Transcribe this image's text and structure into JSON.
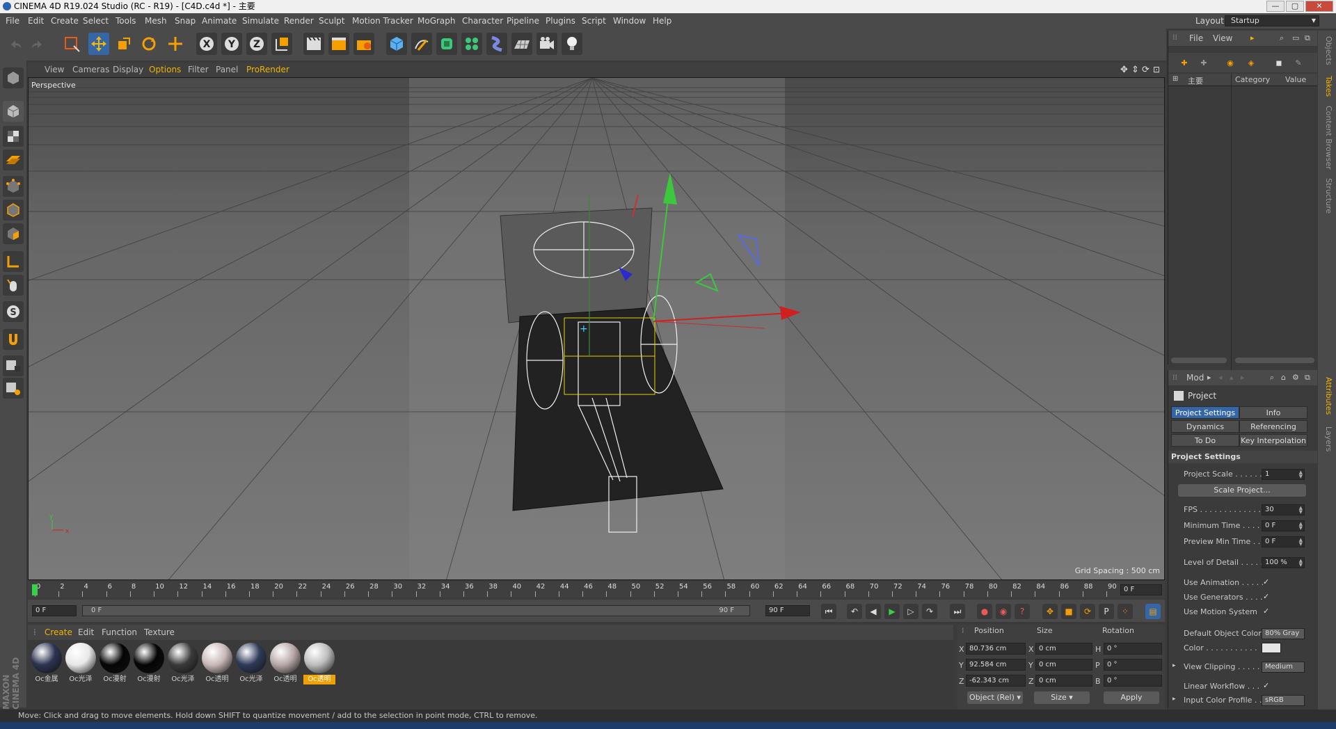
{
  "window": {
    "title": "CINEMA 4D R19.024 Studio (RC - R19) - [C4D.c4d *] - 主要",
    "buttons": [
      "—",
      "▢",
      "✕"
    ]
  },
  "menubar": {
    "items": [
      "File",
      "Edit",
      "Create",
      "Select",
      "Tools",
      "Mesh",
      "Snap",
      "Animate",
      "Simulate",
      "Render",
      "Sculpt",
      "Motion Tracker",
      "MoGraph",
      "Character",
      "Pipeline",
      "Plugins",
      "Script",
      "Window",
      "Help"
    ],
    "layout_label": "Layout:",
    "layout_value": "Startup"
  },
  "toolbar": {
    "axis_x": "X",
    "axis_y": "Y",
    "axis_z": "Z"
  },
  "viewport": {
    "menu": [
      "View",
      "Cameras",
      "Display",
      "Options",
      "Filter",
      "Panel",
      "ProRender"
    ],
    "active_menu": "Options",
    "label": "Perspective",
    "grid_spacing": "Grid Spacing : 500 cm",
    "axis_x": "x",
    "axis_y": "y"
  },
  "timeline": {
    "ticks": [
      "0",
      "2",
      "4",
      "6",
      "8",
      "10",
      "12",
      "14",
      "16",
      "18",
      "20",
      "22",
      "24",
      "26",
      "28",
      "30",
      "32",
      "34",
      "36",
      "38",
      "40",
      "42",
      "44",
      "46",
      "48",
      "50",
      "52",
      "54",
      "56",
      "58",
      "60",
      "62",
      "64",
      "66",
      "68",
      "70",
      "72",
      "74",
      "76",
      "78",
      "80",
      "82",
      "84",
      "86",
      "88",
      "90"
    ],
    "current_frame": "0 F",
    "start_field": "0 F",
    "range_start": "0 F",
    "range_end": "90 F",
    "end_field": "90 F",
    "current_frame_pct": 0
  },
  "materials": {
    "menu": [
      "Create",
      "Edit",
      "Function",
      "Texture"
    ],
    "items": [
      {
        "label": "Oc金属",
        "color": "#2b3350"
      },
      {
        "label": "Oc光泽",
        "color": "#e8e8e8"
      },
      {
        "label": "Oc漫射",
        "color": "#050505"
      },
      {
        "label": "Oc漫射",
        "color": "#050505"
      },
      {
        "label": "Oc光泽",
        "color": "#3a3a3a"
      },
      {
        "label": "Oc透明",
        "color": "#c9b8b8"
      },
      {
        "label": "Oc光泽",
        "color": "#2f3a58"
      },
      {
        "label": "Oc透明",
        "color": "#b8a8a8"
      },
      {
        "label": "Oc透明",
        "color": "#bdbdbd"
      }
    ],
    "selected_index": 8
  },
  "coordinates": {
    "headers": [
      "Position",
      "Size",
      "Rotation"
    ],
    "rows": [
      {
        "axis": "X",
        "position": "80.736 cm",
        "size_axis": "X",
        "size": "0 cm",
        "rot_axis": "H",
        "rotation": "0 °"
      },
      {
        "axis": "Y",
        "position": "92.584 cm",
        "size_axis": "Y",
        "size": "0 cm",
        "rot_axis": "P",
        "rotation": "0 °"
      },
      {
        "axis": "Z",
        "position": "-62.343 cm",
        "size_axis": "Z",
        "size": "0 cm",
        "rot_axis": "B",
        "rotation": "0 °"
      }
    ],
    "mode": "Object (Rel)",
    "size_mode": "Size",
    "apply": "Apply"
  },
  "object_manager": {
    "menu": [
      "File",
      "View"
    ],
    "header_col1": "主要",
    "header_col2": "Category",
    "header_col3": "Value"
  },
  "right_tabs_top": [
    "Objects",
    "Takes",
    "Content Browser",
    "Structure"
  ],
  "right_tabs_bottom": [
    "Attributes",
    "Layers"
  ],
  "attributes": {
    "mode": "Mod",
    "object": "Project",
    "tabs": [
      [
        "Project Settings",
        "Info"
      ],
      [
        "Dynamics",
        "Referencing"
      ],
      [
        "To Do",
        "Key Interpolation"
      ]
    ],
    "active_tab": "Project Settings",
    "section": "Project Settings",
    "fields": [
      {
        "label": "Project Scale . . . . . .",
        "value": "1"
      },
      {
        "label": "FPS . . . . . . . . . . . . . .",
        "value": "30"
      },
      {
        "label": "Minimum Time . . . . .",
        "value": "0 F"
      },
      {
        "label": "Preview Min Time . . .",
        "value": "0 F"
      },
      {
        "label": "Level of Detail . . . . .",
        "value": "100 %"
      }
    ],
    "scale_button": "Scale Project...",
    "checks": [
      {
        "label": "Use Animation . . . . .",
        "value": "✓"
      },
      {
        "label": "Use Generators . . . .",
        "value": "✓"
      },
      {
        "label": "Use Motion System",
        "value": "✓"
      }
    ],
    "default_color_label": "Default Object Color",
    "default_color_value": "80% Gray",
    "color_label": "Color . . . . . . . . . . .",
    "color_swatch": "#e6e6e6",
    "view_clipping_label": "View Clipping . . . . .",
    "view_clipping_value": "Medium",
    "linear_workflow_label": "Linear Workflow . . .",
    "linear_workflow_value": "✓",
    "input_profile_label": "Input Color Profile . .",
    "input_profile_value": "sRGB"
  },
  "status": {
    "text": "Move: Click and drag to move elements. Hold down SHIFT to quantize movement / add to the selection in point mode, CTRL to remove."
  },
  "brand": "MAXON CINEMA 4D",
  "colors": {
    "accent": "#3567a8",
    "selected_material": "#f0a000",
    "timeline_marker": "#37d047"
  }
}
